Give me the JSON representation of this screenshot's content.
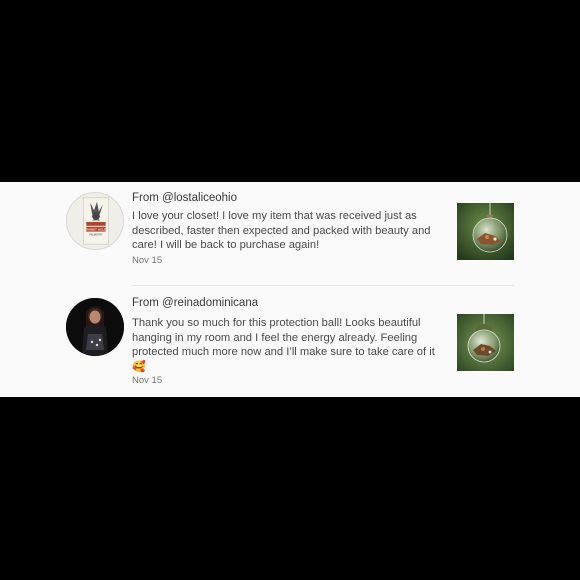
{
  "reviews": [
    {
      "from_label": "From",
      "username": "@lostaliceohio",
      "text": "I love your closet! I love my item that was received just as described, faster then expected and packed with beauty and care! I will be back to purchase again!",
      "date": "Nov 15",
      "avatar_icon": "book-cover-avatar",
      "avatar_text": [
        "ALICE",
        "RABBIT HOLE",
        "PALMISTRY"
      ],
      "thumbnail_icon": "glass-orb-ornament-photo"
    },
    {
      "from_label": "From",
      "username": "@reinadominicana",
      "text": "Thank you so much for this protection ball! Looks beautiful hanging in my room and I feel the energy already. Feeling protected much more now and I’ll make sure to take care of it",
      "emoji": "🥰",
      "date": "Nov 15",
      "avatar_icon": "user-photo-avatar",
      "thumbnail_icon": "glass-orb-ornament-photo"
    }
  ],
  "colors": {
    "background": "#000000",
    "panel": "#fafafa",
    "text": "#4a4a4a",
    "muted": "#777777"
  }
}
